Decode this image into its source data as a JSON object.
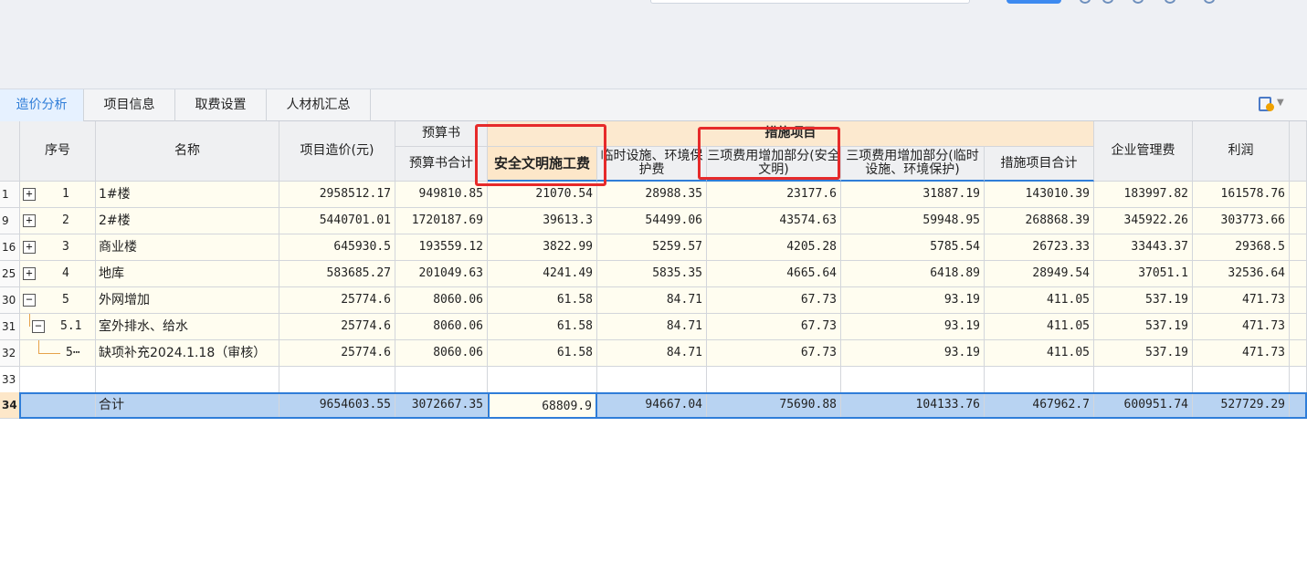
{
  "tabs": [
    "造价分析",
    "项目信息",
    "取费设置",
    "人材机汇总"
  ],
  "active_tab": "造价分析",
  "headers": {
    "seq": "序号",
    "name": "名称",
    "cost": "项目造价(元)",
    "budget_group": "预算书",
    "budget_total": "预算书合计",
    "measures_group": "措施项目",
    "safety_fee": "安全文明施工费",
    "temp_facility": "临时设施、环境保护费",
    "three_safety": "三项费用增加部分(安全文明)",
    "three_temp": "三项费用增加部分(临时设施、环境保护)",
    "measures_total": "措施项目合计",
    "mgmt_fee": "企业管理费",
    "profit": "利润"
  },
  "rows": [
    {
      "rowno": "1",
      "toggle": "+",
      "seq": "1",
      "name": "1#楼",
      "cost": "2958512.17",
      "budget": "949810.85",
      "safety": "21070.54",
      "temp": "28988.35",
      "three_s": "23177.6",
      "three_t": "31887.19",
      "meas": "143010.39",
      "mgmt": "183997.82",
      "profit": "161578.76"
    },
    {
      "rowno": "9",
      "toggle": "+",
      "seq": "2",
      "name": "2#楼",
      "cost": "5440701.01",
      "budget": "1720187.69",
      "safety": "39613.3",
      "temp": "54499.06",
      "three_s": "43574.63",
      "three_t": "59948.95",
      "meas": "268868.39",
      "mgmt": "345922.26",
      "profit": "303773.66"
    },
    {
      "rowno": "16",
      "toggle": "+",
      "seq": "3",
      "name": "商业楼",
      "cost": "645930.5",
      "budget": "193559.12",
      "safety": "3822.99",
      "temp": "5259.57",
      "three_s": "4205.28",
      "three_t": "5785.54",
      "meas": "26723.33",
      "mgmt": "33443.37",
      "profit": "29368.5"
    },
    {
      "rowno": "25",
      "toggle": "+",
      "seq": "4",
      "name": "地库",
      "cost": "583685.27",
      "budget": "201049.63",
      "safety": "4241.49",
      "temp": "5835.35",
      "three_s": "4665.64",
      "three_t": "6418.89",
      "meas": "28949.54",
      "mgmt": "37051.1",
      "profit": "32536.64"
    },
    {
      "rowno": "30",
      "toggle": "−",
      "seq": "5",
      "name": "外网增加",
      "cost": "25774.6",
      "budget": "8060.06",
      "safety": "61.58",
      "temp": "84.71",
      "three_s": "67.73",
      "three_t": "93.19",
      "meas": "411.05",
      "mgmt": "537.19",
      "profit": "471.73"
    },
    {
      "rowno": "31",
      "toggle": "−",
      "seq": "5.1",
      "name": "室外排水、给水",
      "cost": "25774.6",
      "budget": "8060.06",
      "safety": "61.58",
      "temp": "84.71",
      "three_s": "67.73",
      "three_t": "93.19",
      "meas": "411.05",
      "mgmt": "537.19",
      "profit": "471.73"
    },
    {
      "rowno": "32",
      "toggle": "",
      "seq": "5⋯",
      "name": "缺项补充2024.1.18（审核）",
      "cost": "25774.6",
      "budget": "8060.06",
      "safety": "61.58",
      "temp": "84.71",
      "three_s": "67.73",
      "three_t": "93.19",
      "meas": "411.05",
      "mgmt": "537.19",
      "profit": "471.73"
    },
    {
      "rowno": "33",
      "toggle": "",
      "seq": "",
      "name": "",
      "cost": "",
      "budget": "",
      "safety": "",
      "temp": "",
      "three_s": "",
      "three_t": "",
      "meas": "",
      "mgmt": "",
      "profit": ""
    }
  ],
  "total": {
    "rowno": "34",
    "name": "合计",
    "cost": "9654603.55",
    "budget": "3072667.35",
    "safety": "68809.9",
    "temp": "94667.04",
    "three_s": "75690.88",
    "three_t": "104133.76",
    "meas": "467962.7",
    "mgmt": "600951.74",
    "profit": "527729.29"
  },
  "colors": {
    "accent": "#2f7dd8",
    "highlight_box": "#e62a2a",
    "group_header": "#fce9cf",
    "total_row": "#b8d3f2"
  }
}
